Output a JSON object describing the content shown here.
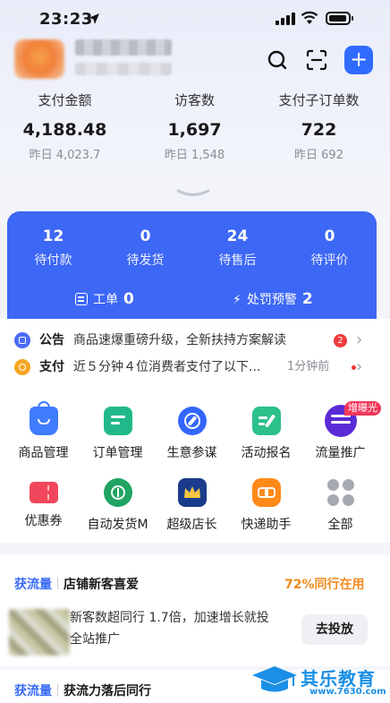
{
  "status_bar": {
    "time": "23:23"
  },
  "header": {
    "add_label": "+"
  },
  "stats": [
    {
      "label": "支付金额",
      "value": "4,188.48",
      "prev": "昨日 4,023.7"
    },
    {
      "label": "访客数",
      "value": "1,697",
      "prev": "昨日 1,548"
    },
    {
      "label": "支付子订单数",
      "value": "722",
      "prev": "昨日 692"
    }
  ],
  "orders": [
    {
      "count": "12",
      "label": "待付款"
    },
    {
      "count": "0",
      "label": "待发货"
    },
    {
      "count": "24",
      "label": "待售后"
    },
    {
      "count": "0",
      "label": "待评价"
    }
  ],
  "panel": {
    "ticket_label": "工单",
    "ticket_count": "0",
    "penalty_label": "处罚预警",
    "penalty_count": "2"
  },
  "notices": [
    {
      "tag": "公告",
      "text": "商品速爆重磅升级，全新扶持方案解读",
      "count": "2"
    },
    {
      "tag": "支付",
      "text": "近５分钟４位消费者支付了以下...",
      "time": "1分钟前"
    }
  ],
  "grid": [
    {
      "label": "商品管理",
      "icon": "shopping-bag-icon",
      "color": "#3f7cff"
    },
    {
      "label": "订单管理",
      "icon": "order-list-icon",
      "color": "#22b98a"
    },
    {
      "label": "生意参谋",
      "icon": "compass-icon",
      "color": "#3366ff"
    },
    {
      "label": "活动报名",
      "icon": "edit-form-icon",
      "color": "#2cc08b"
    },
    {
      "label": "流量推广",
      "icon": "wanxiangtai-icon",
      "color": "#5b2bd6",
      "badge": "增曝光"
    },
    {
      "label": "优惠券",
      "icon": "coupon-icon",
      "color": "#f1475c"
    },
    {
      "label": "自动发货M",
      "icon": "auto-ship-icon",
      "color": "#1fa463"
    },
    {
      "label": "超级店长",
      "icon": "crown-icon",
      "color": "#1b3c8c"
    },
    {
      "label": "快递助手",
      "icon": "delivery-link-icon",
      "color": "#ff8a1a"
    },
    {
      "label": "全部",
      "icon": "all-grid-icon",
      "color": "#a6a9b0"
    }
  ],
  "cards": [
    {
      "key": "获流量",
      "title": "店铺新客喜爱",
      "tag": "72%同行在用",
      "line1": "新客数超同行 1.7倍，加速增长就投",
      "line2": "全站推广",
      "button": "去投放"
    },
    {
      "key": "获流量",
      "title": "获流力落后同行"
    }
  ],
  "watermark": {
    "brand": "其乐教育",
    "url": "www.7630.com"
  },
  "colors": {
    "accent": "#3d67f5",
    "warning": "#f28a1b",
    "alert": "#f03a3a"
  }
}
